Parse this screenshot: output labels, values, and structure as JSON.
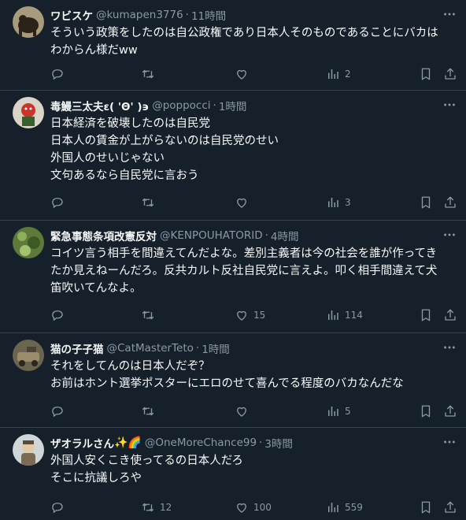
{
  "tweets": [
    {
      "name": "ワビスケ",
      "handle": "@kumapen3776",
      "dot": "·",
      "time": "11時間",
      "lines": [
        "そういう政策をしたのは自公政権であり日本人そのものであることにバカは",
        "わからん様だww"
      ],
      "replies": "",
      "retweets": "",
      "likes": "",
      "views": "2"
    },
    {
      "name": "毒鰻三太夫ε( 'Θ' )϶",
      "handle": "@poppocci",
      "dot": "·",
      "time": "1時間",
      "lines": [
        "日本経済を破壊したのは自民党",
        "日本人の賃金が上がらないのは自民党のせい",
        "外国人のせいじゃない",
        "文句あるなら自民党に言おう"
      ],
      "replies": "",
      "retweets": "",
      "likes": "",
      "views": "3"
    },
    {
      "name": "緊急事態条項改憲反対",
      "handle": "@KENPOUHATORID",
      "dot": "·",
      "time": "4時間",
      "lines": [
        "コイツ言う相手を間違えてんだよな。差別主義者は今の社会を誰が作ってき",
        "たか見えねーんだろ。反共カルト反社自民党に言えよ。叩く相手間違えて犬",
        "笛吹いてんなよ。"
      ],
      "replies": "",
      "retweets": "",
      "likes": "15",
      "views": "114"
    },
    {
      "name": "猫の子子猫",
      "handle": "@CatMasterTeto",
      "dot": "·",
      "time": "1時間",
      "lines": [
        "それをしてんのは日本人だぞ？",
        "お前はホント選挙ポスターにエロのせて喜んでる程度のバカなんだな"
      ],
      "replies": "",
      "retweets": "",
      "likes": "",
      "views": "5"
    },
    {
      "name": "ザオラルさん",
      "name_emoji": "✨🌈",
      "handle": "@OneMoreChance99",
      "dot": "·",
      "time": "3時間",
      "lines": [
        "外国人安くこき使ってるの日本人だろ",
        "そこに抗議しろや"
      ],
      "replies": "",
      "retweets": "12",
      "likes": "100",
      "views": "559"
    }
  ],
  "icons": {
    "reply": "reply-icon",
    "retweet": "retweet-icon",
    "like": "heart-icon",
    "views": "views-icon",
    "bookmark": "bookmark-icon",
    "share": "share-icon",
    "more": "more-icon"
  },
  "colors": {
    "background": "#15202b",
    "text": "#f7f9f9",
    "secondary": "#8b98a5",
    "divider": "#38444d"
  }
}
